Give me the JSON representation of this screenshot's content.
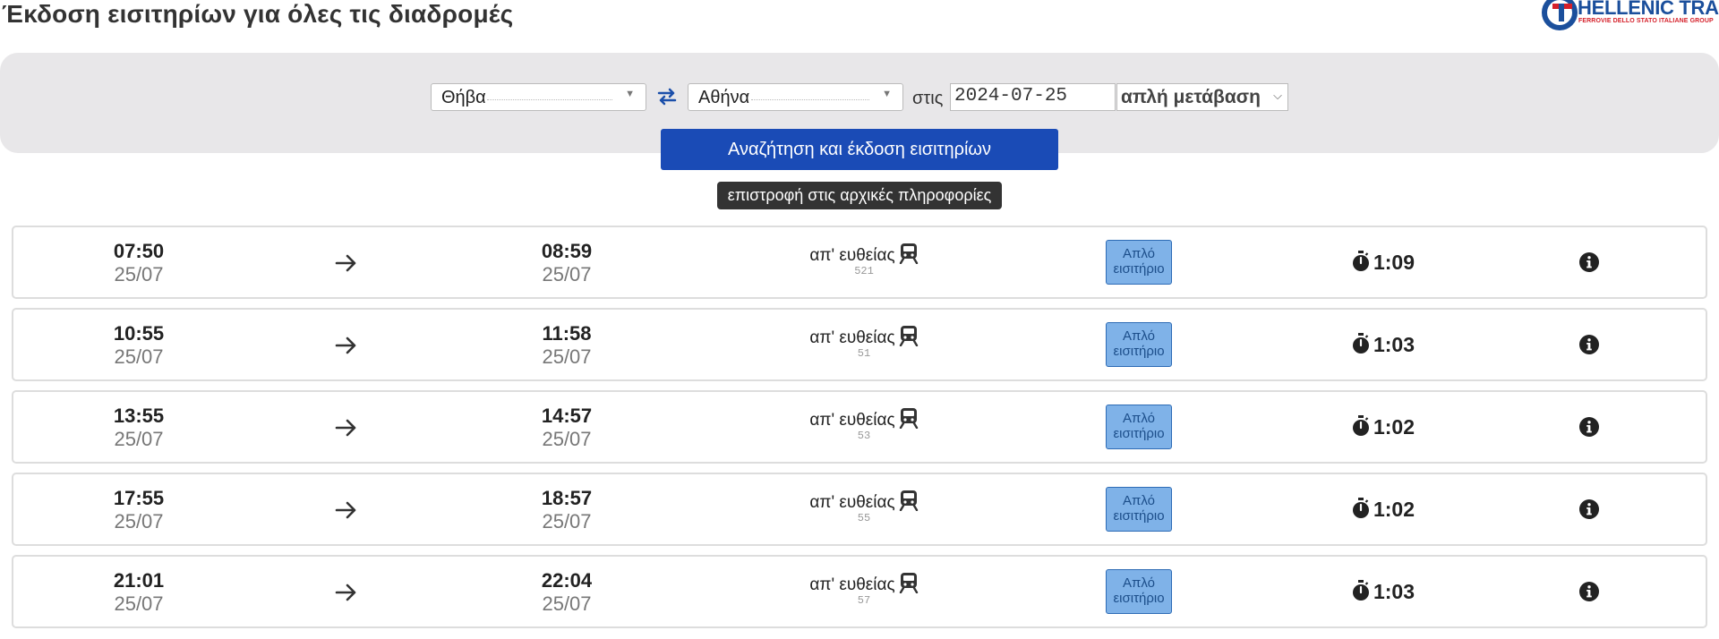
{
  "page": {
    "title": "Έκδοση εισιτηρίων για όλες τις διαδρομές"
  },
  "logo": {
    "brand": "HELLENIC TRAIN",
    "tagline": "FERROVIE DELLO STATO ITALIANE GROUP",
    "colors": {
      "blue": "#1b4f9c",
      "red": "#d5202a"
    }
  },
  "search": {
    "from": "Θήβα",
    "to": "Αθήνα",
    "on_label": "στις",
    "date": "2024-07-25",
    "trip_type": "απλή μετάβαση",
    "submit_label": "Αναζήτηση και έκδοση εισιτηρίων",
    "tooltip": "επιστροφή στις αρχικές πληροφορίες"
  },
  "results": [
    {
      "dep_time": "07:50",
      "dep_date": "25/07",
      "arr_time": "08:59",
      "arr_date": "25/07",
      "route": "απ' ευθείας",
      "train_no": "521",
      "ticket_line1": "Απλό",
      "ticket_line2": "εισιτήριο",
      "duration": "1:09"
    },
    {
      "dep_time": "10:55",
      "dep_date": "25/07",
      "arr_time": "11:58",
      "arr_date": "25/07",
      "route": "απ' ευθείας",
      "train_no": "51",
      "ticket_line1": "Απλό",
      "ticket_line2": "εισιτήριο",
      "duration": "1:03"
    },
    {
      "dep_time": "13:55",
      "dep_date": "25/07",
      "arr_time": "14:57",
      "arr_date": "25/07",
      "route": "απ' ευθείας",
      "train_no": "53",
      "ticket_line1": "Απλό",
      "ticket_line2": "εισιτήριο",
      "duration": "1:02"
    },
    {
      "dep_time": "17:55",
      "dep_date": "25/07",
      "arr_time": "18:57",
      "arr_date": "25/07",
      "route": "απ' ευθείας",
      "train_no": "55",
      "ticket_line1": "Απλό",
      "ticket_line2": "εισιτήριο",
      "duration": "1:02"
    },
    {
      "dep_time": "21:01",
      "dep_date": "25/07",
      "arr_time": "22:04",
      "arr_date": "25/07",
      "route": "απ' ευθείας",
      "train_no": "57",
      "ticket_line1": "Απλό",
      "ticket_line2": "εισιτήριο",
      "duration": "1:03"
    }
  ],
  "icons": {
    "swap": "swap-arrows-icon",
    "arrow": "arrow-right-icon",
    "train": "train-icon",
    "stopwatch": "stopwatch-icon",
    "info": "info-circle-icon"
  },
  "colors": {
    "primary_button": "#1a4bb6",
    "ticket_button": "#7fb2e8",
    "panel_bg": "#e8e7e9",
    "tooltip_bg": "#333333"
  }
}
